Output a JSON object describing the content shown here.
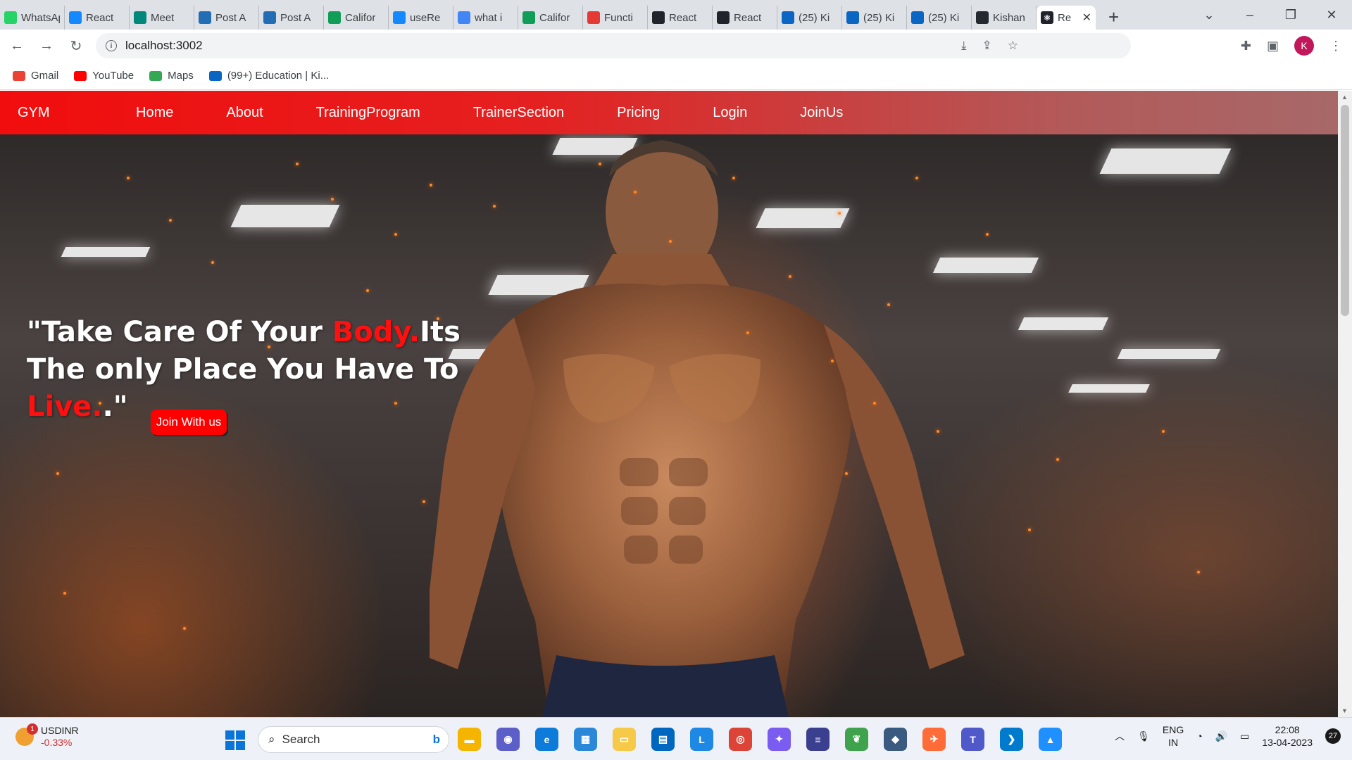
{
  "browser": {
    "tabs": [
      {
        "title": "WhatsApp",
        "icon": "whatsapp-icon",
        "color": "#25d366"
      },
      {
        "title": "React",
        "icon": "stackblitz-icon",
        "color": "#1389fd"
      },
      {
        "title": "Meet",
        "icon": "google-meet-icon",
        "color": "#00897b"
      },
      {
        "title": "Post A",
        "icon": "zoho-icon",
        "color": "#226db4"
      },
      {
        "title": "Post A",
        "icon": "zoho-icon",
        "color": "#226db4"
      },
      {
        "title": "Califor",
        "icon": "sheets-icon",
        "color": "#0f9d58"
      },
      {
        "title": "useRe",
        "icon": "stackblitz-icon",
        "color": "#1389fd"
      },
      {
        "title": "what i",
        "icon": "google-icon",
        "color": "#4285f4"
      },
      {
        "title": "Califor",
        "icon": "sheets-icon",
        "color": "#0f9d58"
      },
      {
        "title": "Functi",
        "icon": "shield-icon",
        "color": "#e53935"
      },
      {
        "title": "React",
        "icon": "react-icon",
        "color": "#20232a"
      },
      {
        "title": "React",
        "icon": "react-icon",
        "color": "#20232a"
      },
      {
        "title": "(25) Ki",
        "icon": "linkedin-icon",
        "color": "#0a66c2"
      },
      {
        "title": "(25) Ki",
        "icon": "linkedin-icon",
        "color": "#0a66c2"
      },
      {
        "title": "(25) Ki",
        "icon": "linkedin-icon",
        "color": "#0a66c2"
      },
      {
        "title": "Kishan",
        "icon": "github-icon",
        "color": "#24292f"
      }
    ],
    "active_tab": {
      "title": "Re",
      "icon": "react-icon",
      "color": "#20232a"
    },
    "url": "localhost:3002",
    "bookmarks": [
      {
        "label": "Gmail",
        "icon": "gmail-icon",
        "color": "#ea4335"
      },
      {
        "label": "YouTube",
        "icon": "youtube-icon",
        "color": "#ff0000"
      },
      {
        "label": "Maps",
        "icon": "maps-icon",
        "color": "#34a853"
      },
      {
        "label": "(99+) Education | Ki...",
        "icon": "linkedin-icon",
        "color": "#0a66c2"
      }
    ],
    "profile_initial": "K"
  },
  "page": {
    "brand": "GYM",
    "nav": [
      "Home",
      "About",
      "TrainingProgram",
      "TrainerSection",
      "Pricing",
      "Login",
      "JoinUs"
    ],
    "tagline": {
      "part1": "\"Take Care Of Your ",
      "highlight1": "Body.",
      "part2": "Its The only Place You Have To ",
      "highlight2": "Live.",
      "part3": ".\""
    },
    "cta": "Join With us",
    "accent": "#ff0000"
  },
  "taskbar": {
    "widget_badge": "1",
    "ticker": "USDINR",
    "change": "-0.33%",
    "search_placeholder": "Search",
    "apps": [
      {
        "icon": "file-explorer-icon",
        "color": "#f4b400",
        "glyph": "▬"
      },
      {
        "icon": "teams-meet-icon",
        "color": "#5b5fc7",
        "glyph": "◉"
      },
      {
        "icon": "edge-icon",
        "color": "#0c7bd9",
        "glyph": "e"
      },
      {
        "icon": "calculator-icon",
        "color": "#2b88d8",
        "glyph": "▦"
      },
      {
        "icon": "folder-icon",
        "color": "#f7c948",
        "glyph": "▭"
      },
      {
        "icon": "store-icon",
        "color": "#0067c0",
        "glyph": "▤"
      },
      {
        "icon": "l-app-icon",
        "color": "#1e88e5",
        "glyph": "L"
      },
      {
        "icon": "chrome-icon",
        "color": "#db4437",
        "glyph": "◎"
      },
      {
        "icon": "copilot-icon",
        "color": "#7a5cf0",
        "glyph": "✦"
      },
      {
        "icon": "disk-icon",
        "color": "#3b3f8f",
        "glyph": "≡"
      },
      {
        "icon": "leaf-icon",
        "color": "#3fa34d",
        "glyph": "❦"
      },
      {
        "icon": "box-icon",
        "color": "#3a5a80",
        "glyph": "◆"
      },
      {
        "icon": "postman-icon",
        "color": "#ff6c37",
        "glyph": "✈"
      },
      {
        "icon": "teams-icon",
        "color": "#5059c9",
        "glyph": "T"
      },
      {
        "icon": "vscode-icon",
        "color": "#007acc",
        "glyph": "❯"
      },
      {
        "icon": "photos-icon",
        "color": "#1e90ff",
        "glyph": "▲"
      }
    ],
    "lang": "ENG",
    "region": "IN",
    "time": "22:08",
    "date": "13-04-2023",
    "notifications": "27"
  }
}
